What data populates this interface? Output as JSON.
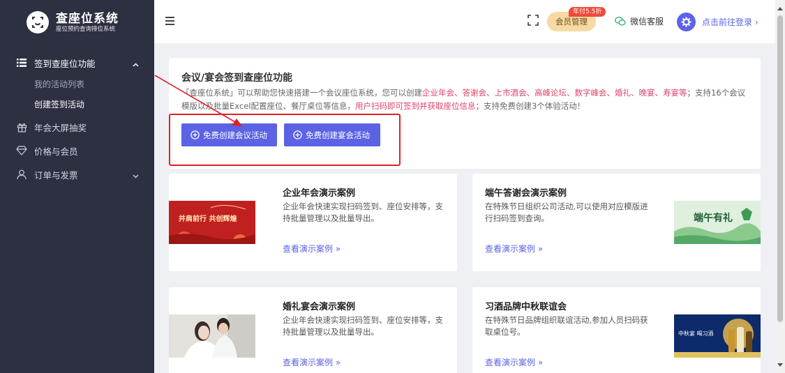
{
  "app": {
    "name": "查座位系统",
    "subtitle": "座位预约查询排位系统"
  },
  "sidebar": {
    "menu": [
      {
        "label": "签到查座位功能",
        "icon": "list-icon",
        "expanded": true,
        "children": [
          {
            "label": "我的活动列表"
          },
          {
            "label": "创建签到活动"
          }
        ]
      },
      {
        "label": "年会大屏抽奖",
        "icon": "gift-icon"
      },
      {
        "label": "价格与会员",
        "icon": "diamond-icon"
      },
      {
        "label": "订单与发票",
        "icon": "user-icon"
      }
    ]
  },
  "header": {
    "vip_label": "会员管理",
    "vip_badge": "年付5.5折",
    "service_label": "微信客服",
    "login_label": "点击前往登录 ›"
  },
  "intro": {
    "title": "会议/宴会签到查座位功能",
    "desc_part1": "「查座位系统」可以帮助您快速搭建一个会议座位系统，您可以创建",
    "desc_hl1": "企业年会、答谢会、上市酒会、高峰论坛、数字峰会、婚礼、晚宴、寿宴等",
    "desc_part2": "；支持16个会议模版以及批量Excel配置座位、餐厅桌位等信息，",
    "desc_hl2": "用户扫码即可签到并获取座位信息",
    "desc_part3": "；支持免费创建3个体验活动！",
    "btn_meeting": "免费创建会议活动",
    "btn_banquet": "免费创建宴会活动"
  },
  "cards": [
    {
      "title": "企业年会演示案例",
      "desc": "企业年会快速实现扫码签到、座位安排等，支持批量管理以及批量导出。",
      "link": "查看演示案例 »",
      "image_text": "并肩前行 共创辉煌"
    },
    {
      "title": "端午答谢会演示案例",
      "desc": "在特殊节日组织公司活动,可以使用对应模版进行扫码签到查询。",
      "link": "查看演示案例 »",
      "image_text": "端午有礼"
    },
    {
      "title": "婚礼宴会演示案例",
      "desc": "企业年会快速实现扫码签到、座位安排等，支持批量管理以及批量导出。",
      "link": "查看演示案例 »"
    },
    {
      "title": "习酒品牌中秋联谊会",
      "desc": "在特殊节日品牌组织联谊活动,参加人员扫码获取桌位号。",
      "link": "查看演示案例 »",
      "image_text": "中秋宴 喝习酒"
    }
  ],
  "colors": {
    "sidebar_bg": "#2c3041",
    "accent": "#5b63e4",
    "highlight": "#e0436b",
    "annotation_red": "#e0202a"
  }
}
